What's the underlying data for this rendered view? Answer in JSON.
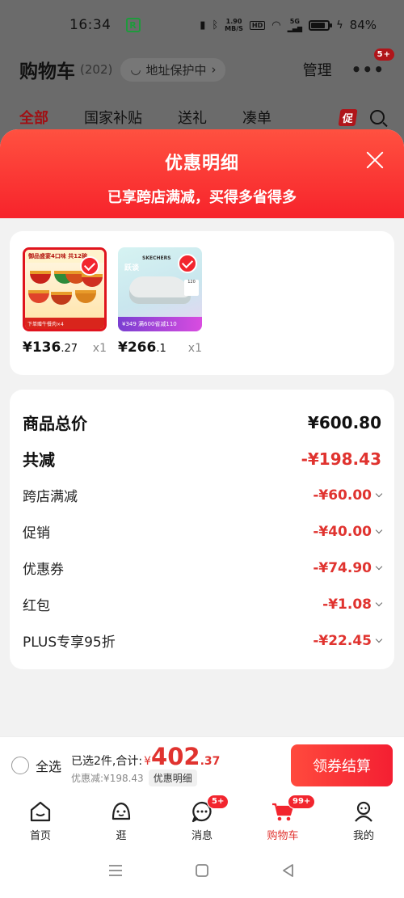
{
  "status_bar": {
    "time": "16:34",
    "net_speed_value": "1.90",
    "net_speed_unit": "MB/S",
    "hd_badge": "HD",
    "signal_label": "5G",
    "battery": "84%",
    "battery_level": 0.84
  },
  "header": {
    "title": "购物车",
    "count": "(202)",
    "address_label": "地址保护中",
    "manage_label": "管理",
    "more_badge": "5+"
  },
  "tabs": [
    {
      "label": "全部",
      "active": true
    },
    {
      "label": "国家补贴",
      "active": false
    },
    {
      "label": "送礼",
      "active": false
    },
    {
      "label": "凑单",
      "active": false
    }
  ],
  "promo_tag": "促",
  "sheet": {
    "title": "优惠明细",
    "subtitle": "已享跨店满减，买得多省得多"
  },
  "products": [
    {
      "banner": "御品盛宴4口味 共12碗",
      "strip": "下单赠牛餐肉×4",
      "price_int": "¥136",
      "price_dec": ".27",
      "qty": "x1"
    },
    {
      "brand": "SKECHERS",
      "word": "跃谈",
      "strip": "¥349  满600省减110",
      "tag": "120",
      "price_int": "¥266",
      "price_dec": ".1",
      "qty": "x1"
    }
  ],
  "details": {
    "total_label": "商品总价",
    "total_value": "¥600.80",
    "reduce_label": "共减",
    "reduce_value": "-¥198.43",
    "items": [
      {
        "label": "跨店满减",
        "value": "-¥60.00"
      },
      {
        "label": "促销",
        "value": "-¥40.00"
      },
      {
        "label": "优惠券",
        "value": "-¥74.90"
      },
      {
        "label": "红包",
        "value": "-¥1.08"
      },
      {
        "label": "PLUS专享95折",
        "value": "-¥22.45"
      }
    ]
  },
  "checkout": {
    "select_all": "全选",
    "selected_text": "已选2件,合计:",
    "currency": "¥",
    "total_int": "402",
    "total_dec": ".37",
    "discount_text": "优惠减:¥198.43",
    "detail_pill": "优惠明细",
    "button": "领券结算"
  },
  "tabbar": [
    {
      "label": "首页",
      "icon": "home-icon",
      "badge": ""
    },
    {
      "label": "逛",
      "icon": "browse-face-icon",
      "badge": ""
    },
    {
      "label": "消息",
      "icon": "message-bubble-icon",
      "badge": "5+"
    },
    {
      "label": "购物车",
      "icon": "cart-icon",
      "badge": "99+",
      "active": true
    },
    {
      "label": "我的",
      "icon": "profile-icon",
      "badge": ""
    }
  ],
  "colors": {
    "accent": "#f2252e",
    "price_red": "#e0332f",
    "sheet_bg": "#f2f2f2"
  }
}
